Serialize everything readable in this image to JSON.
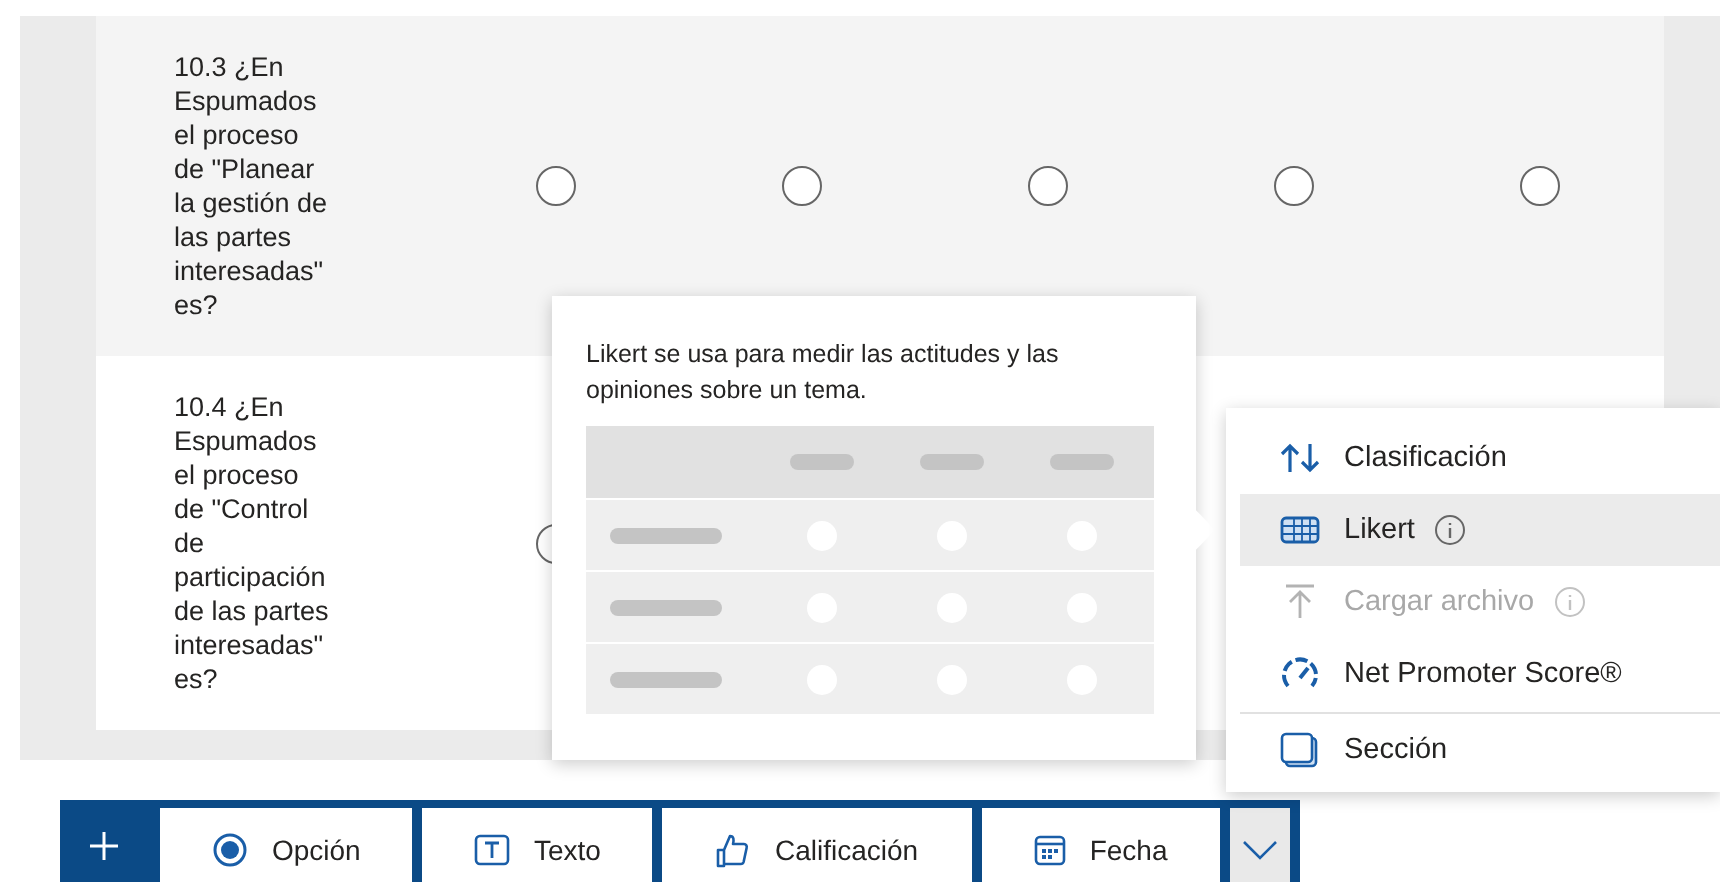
{
  "questions": [
    {
      "text": "10.3 ¿En Espumados el proceso de \"Planear la gestión de las partes interesadas\" es?",
      "options": [
        {
          "selected": false
        },
        {
          "selected": false
        },
        {
          "selected": false
        },
        {
          "selected": false
        },
        {
          "selected": false
        }
      ]
    },
    {
      "text": "10.4 ¿En Espumados el proceso de \"Control de participación de las partes interesadas\" es?",
      "options": [
        {
          "selected": false
        }
      ]
    }
  ],
  "popover": {
    "description": "Likert se usa para medir las actitudes y las opiniones sobre un tema."
  },
  "menu": {
    "items": [
      {
        "label": "Clasificación",
        "kind": "ranking",
        "selected": false,
        "disabled": false,
        "info": false
      },
      {
        "label": "Likert",
        "kind": "likert",
        "selected": true,
        "disabled": false,
        "info": true
      },
      {
        "label": "Cargar archivo",
        "kind": "upload",
        "selected": false,
        "disabled": true,
        "info": true
      },
      {
        "label": "Net Promoter Score®",
        "kind": "nps",
        "selected": false,
        "disabled": false,
        "info": false
      },
      {
        "label": "Sección",
        "kind": "section",
        "selected": false,
        "disabled": false,
        "info": false,
        "divider_before": true
      }
    ]
  },
  "toolbar": {
    "buttons": [
      {
        "label": "Opción",
        "kind": "choice"
      },
      {
        "label": "Texto",
        "kind": "text"
      },
      {
        "label": "Calificación",
        "kind": "rating"
      },
      {
        "label": "Fecha",
        "kind": "date"
      }
    ]
  }
}
